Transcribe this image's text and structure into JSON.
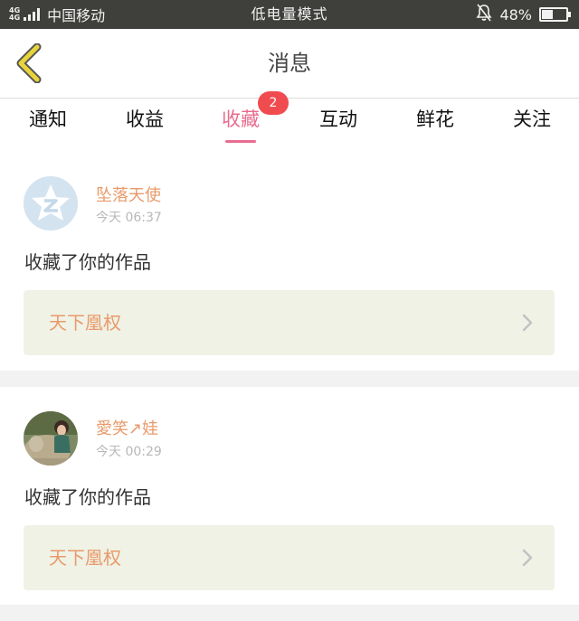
{
  "status_bar": {
    "net_top": "4G",
    "net_bottom": "4G",
    "carrier": "中国移动",
    "mode": "低电量模式",
    "battery": "48%",
    "battery_level": 0.48,
    "icons": [
      "signal-icon",
      "mute-bell-icon",
      "battery-icon"
    ]
  },
  "header": {
    "title": "消息",
    "back_icon": "chevron-left-icon",
    "back_color": "#e8d33a"
  },
  "tabs": [
    {
      "label": "通知",
      "active": false
    },
    {
      "label": "收益",
      "active": false
    },
    {
      "label": "收藏",
      "active": true
    },
    {
      "label": "互动",
      "active": false
    },
    {
      "label": "鲜花",
      "active": false
    },
    {
      "label": "关注",
      "active": false
    }
  ],
  "tab_badge": "2",
  "colors": {
    "accent": "#e96c8f",
    "badge": "#f04b4f",
    "username": "#e89a6a",
    "work_bg": "#f0f2e6"
  },
  "messages": [
    {
      "user": "坠落天使",
      "time": "今天 06:37",
      "action": "收藏了你的作品",
      "work_title": "天下凰权",
      "avatar": "qzone-default-avatar"
    },
    {
      "user": "愛笑↗娃",
      "time": "今天 00:29",
      "action": "收藏了你的作品",
      "work_title": "天下凰权",
      "avatar": "photo-avatar"
    }
  ]
}
